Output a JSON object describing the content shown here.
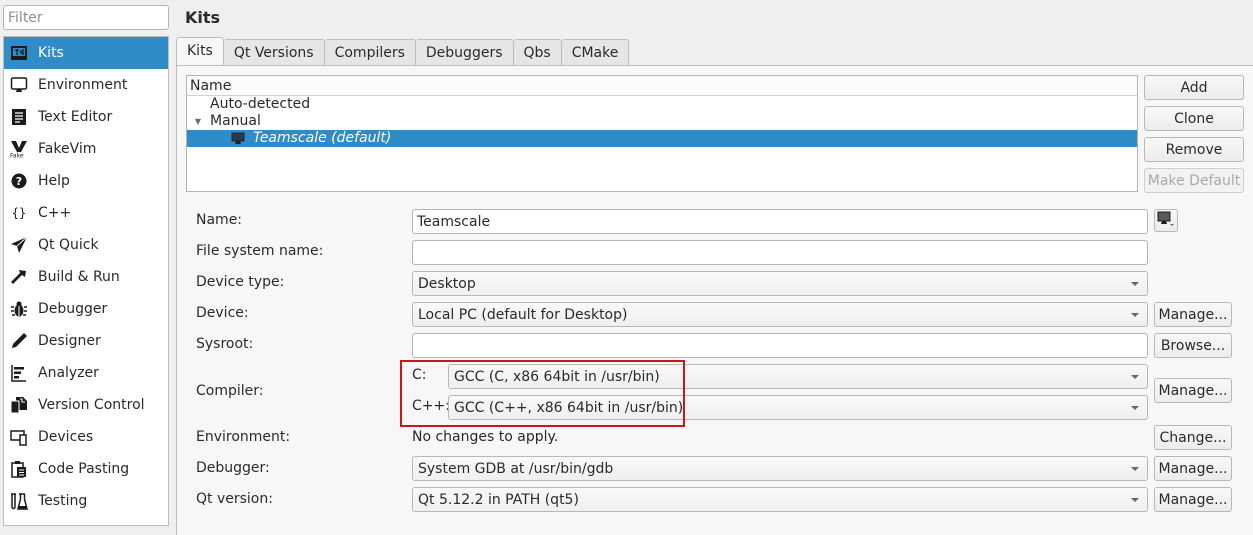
{
  "filter": {
    "placeholder": "Filter",
    "value": ""
  },
  "sidebar": {
    "items": [
      {
        "label": "Kits",
        "icon": "kits-icon",
        "active": true
      },
      {
        "label": "Environment",
        "icon": "monitor-icon"
      },
      {
        "label": "Text Editor",
        "icon": "text-editor-icon"
      },
      {
        "label": "FakeVim",
        "icon": "fakevim-icon"
      },
      {
        "label": "Help",
        "icon": "help-icon"
      },
      {
        "label": "C++",
        "icon": "braces-icon"
      },
      {
        "label": "Qt Quick",
        "icon": "qt-quick-icon"
      },
      {
        "label": "Build & Run",
        "icon": "hammer-icon"
      },
      {
        "label": "Debugger",
        "icon": "bug-icon"
      },
      {
        "label": "Designer",
        "icon": "pen-icon"
      },
      {
        "label": "Analyzer",
        "icon": "analyzer-icon"
      },
      {
        "label": "Version Control",
        "icon": "version-control-icon"
      },
      {
        "label": "Devices",
        "icon": "devices-icon"
      },
      {
        "label": "Code Pasting",
        "icon": "clipboard-icon"
      },
      {
        "label": "Testing",
        "icon": "flask-icon"
      }
    ]
  },
  "page": {
    "title": "Kits"
  },
  "tabs": [
    {
      "label": "Kits",
      "active": true
    },
    {
      "label": "Qt Versions"
    },
    {
      "label": "Compilers"
    },
    {
      "label": "Debuggers"
    },
    {
      "label": "Qbs"
    },
    {
      "label": "CMake"
    }
  ],
  "tree": {
    "header": "Name",
    "rows": [
      {
        "label": "Auto-detected",
        "level": 0,
        "expandable": false
      },
      {
        "label": "Manual",
        "level": 0,
        "expandable": true,
        "expanded": true
      },
      {
        "label": "Teamscale (default)",
        "level": 1,
        "selected": true,
        "icon": "desktop-icon"
      }
    ]
  },
  "kit_buttons": {
    "add": "Add",
    "clone": "Clone",
    "remove": "Remove",
    "make_default": "Make Default"
  },
  "form": {
    "name": {
      "label": "Name:",
      "value": "Teamscale"
    },
    "file_system_name": {
      "label": "File system name:",
      "value": ""
    },
    "device_type": {
      "label": "Device type:",
      "value": "Desktop"
    },
    "device": {
      "label": "Device:",
      "value": "Local PC (default for Desktop)",
      "button": "Manage..."
    },
    "sysroot": {
      "label": "Sysroot:",
      "value": "",
      "button": "Browse..."
    },
    "compiler": {
      "label": "Compiler:",
      "c_label": "C:",
      "c_value": "GCC (C, x86 64bit in /usr/bin)",
      "cpp_label": "C++:",
      "cpp_value": "GCC (C++, x86 64bit in /usr/bin)",
      "button": "Manage..."
    },
    "environment": {
      "label": "Environment:",
      "value": "No changes to apply.",
      "button": "Change..."
    },
    "debugger": {
      "label": "Debugger:",
      "value": "System GDB at /usr/bin/gdb",
      "button": "Manage..."
    },
    "qt_version": {
      "label": "Qt version:",
      "value": "Qt 5.12.2 in PATH (qt5)",
      "button": "Manage..."
    }
  },
  "colors": {
    "selection": "#308cc6",
    "highlight_box": "#c8161d"
  }
}
